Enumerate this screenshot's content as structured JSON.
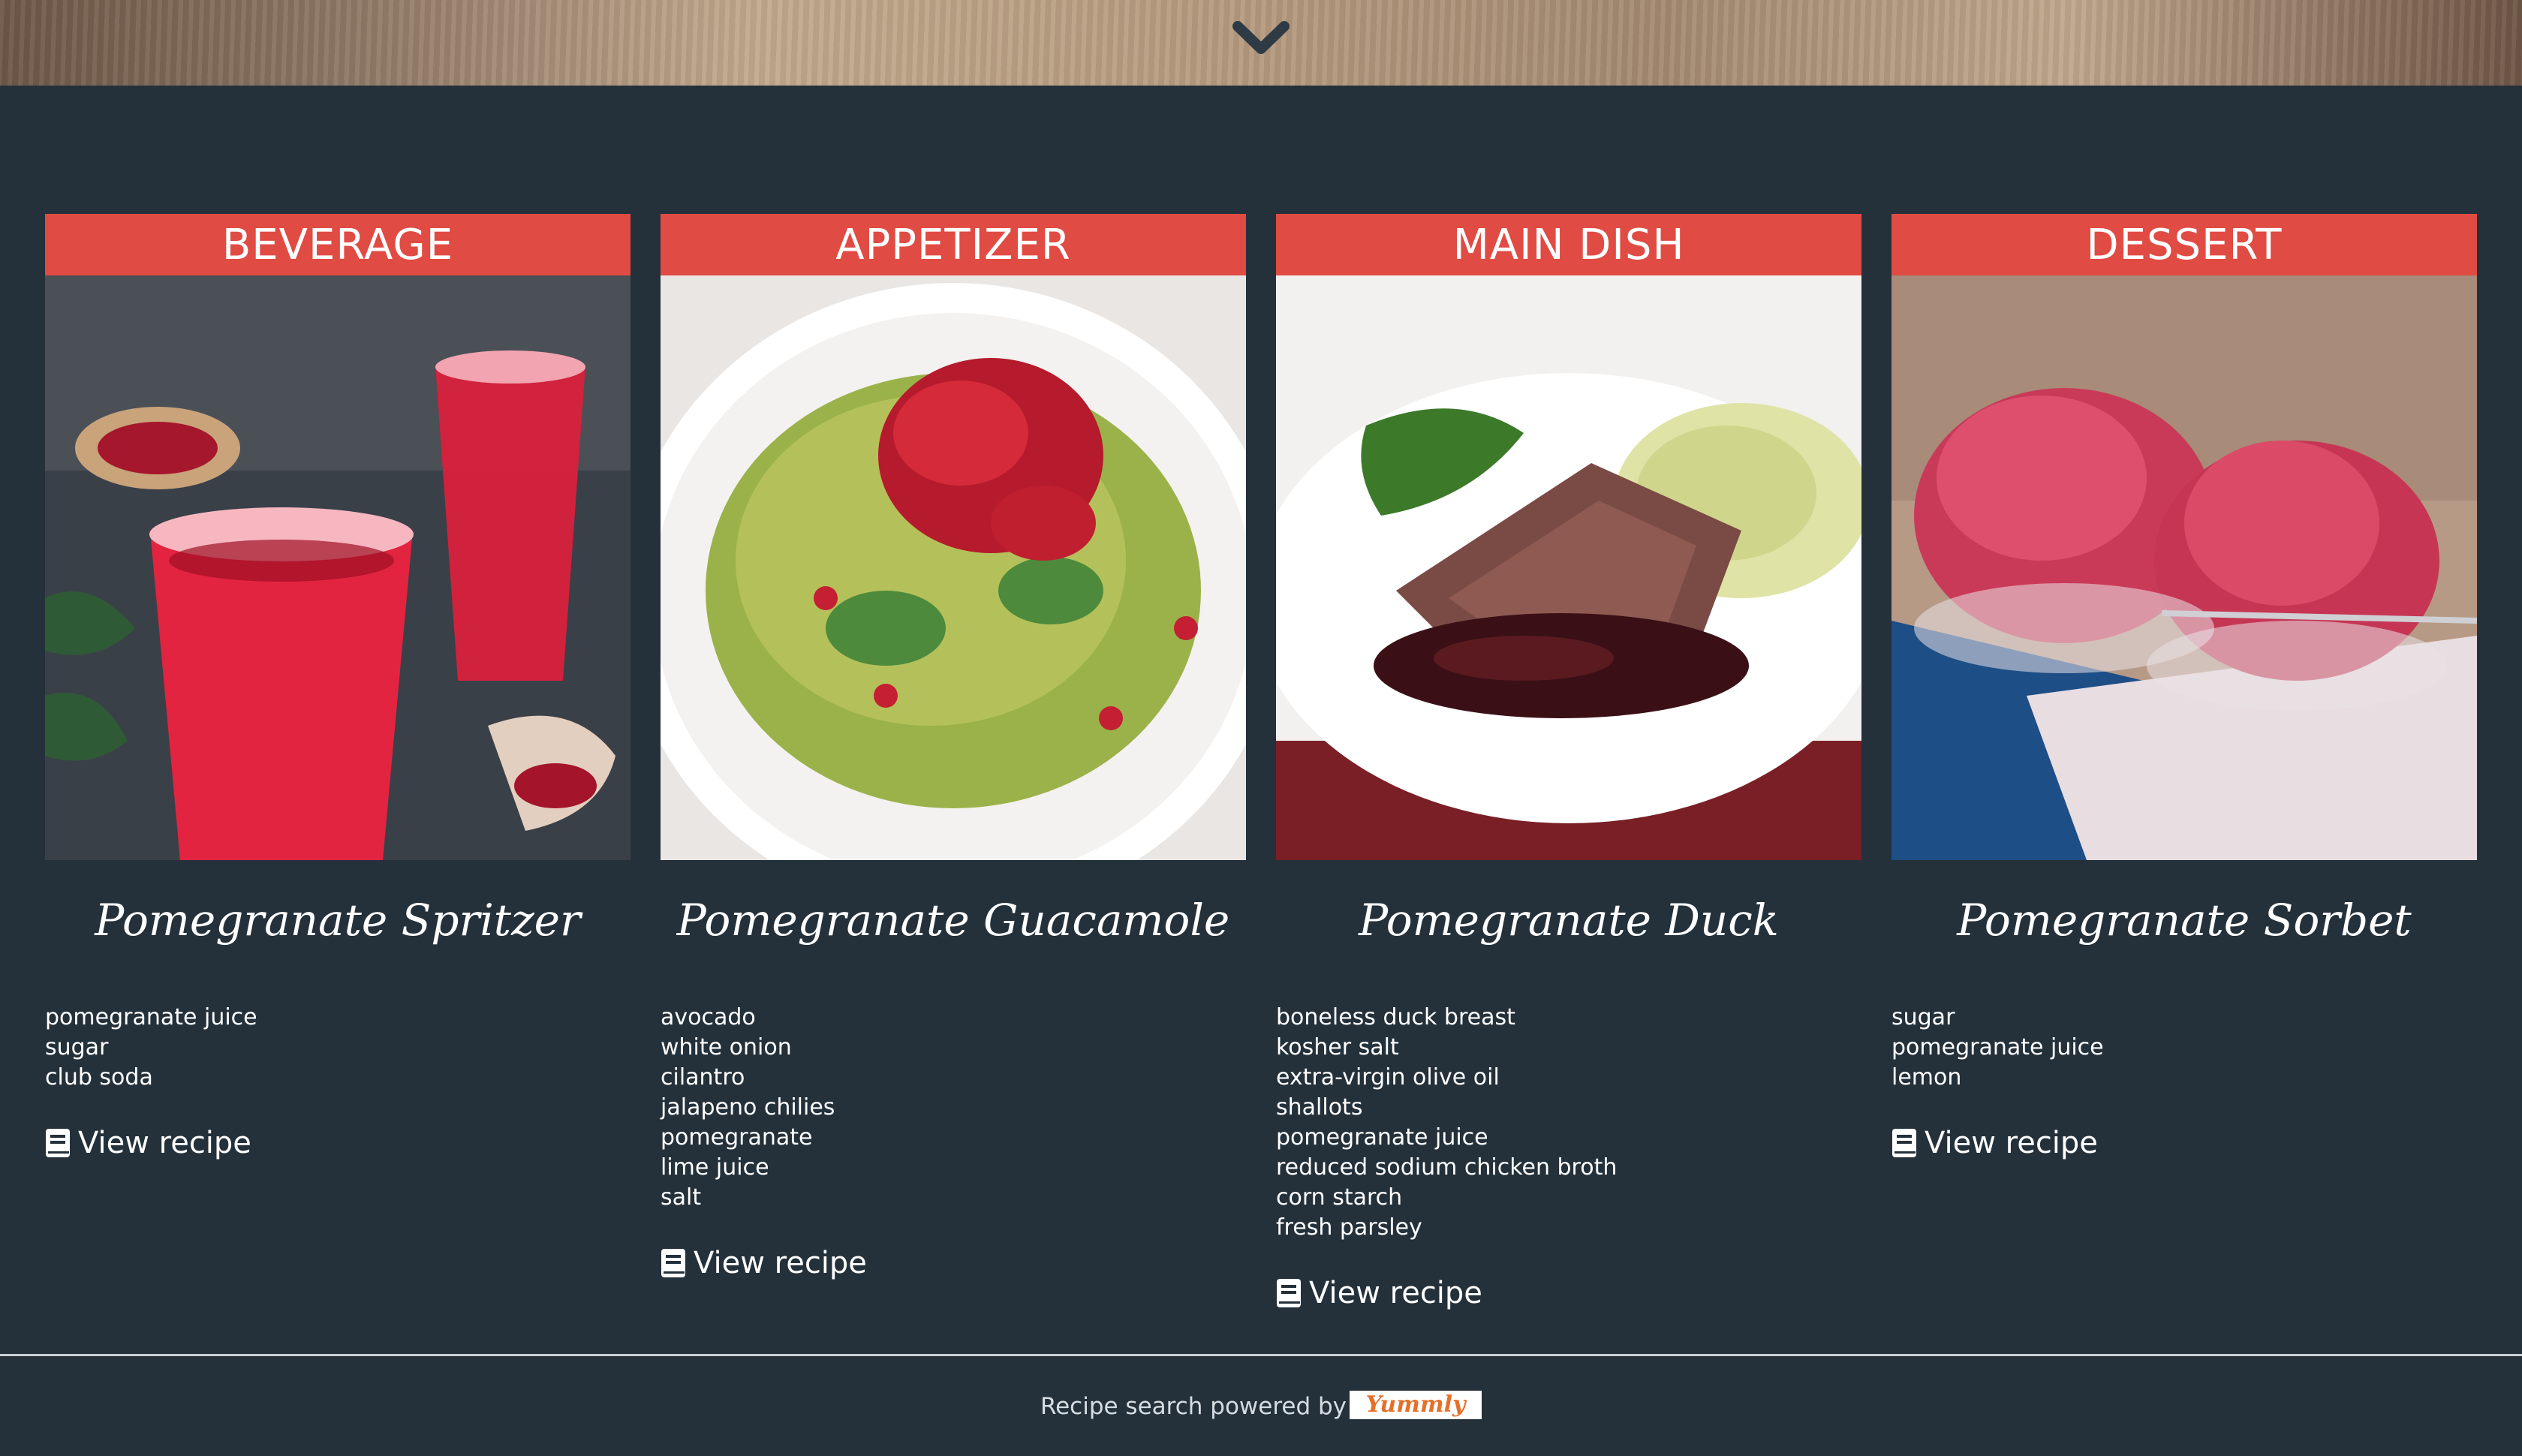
{
  "hero": {
    "scroll_icon": "chevron-down-icon"
  },
  "cards": [
    {
      "category": "BEVERAGE",
      "title": "Pomegranate Spritzer",
      "ingredients": [
        "pomegranate juice",
        "sugar",
        "club soda"
      ],
      "cta": "View recipe"
    },
    {
      "category": "APPETIZER",
      "title": "Pomegranate Guacamole",
      "ingredients": [
        "avocado",
        "white onion",
        "cilantro",
        "jalapeno chilies",
        "pomegranate",
        "lime juice",
        "salt"
      ],
      "cta": "View recipe"
    },
    {
      "category": "MAIN DISH",
      "title": "Pomegranate Duck",
      "ingredients": [
        "boneless duck breast",
        "kosher salt",
        "extra-virgin olive oil",
        "shallots",
        "pomegranate juice",
        "reduced sodium chicken broth",
        "corn starch",
        "fresh parsley"
      ],
      "cta": "View recipe"
    },
    {
      "category": "DESSERT",
      "title": "Pomegranate Sorbet",
      "ingredients": [
        "sugar",
        "pomegranate juice",
        "lemon"
      ],
      "cta": "View recipe"
    }
  ],
  "footer": {
    "text": "Recipe search powered by",
    "logo_text": "Yummly"
  },
  "colors": {
    "background": "#24313b",
    "accent": "#e04b43",
    "footer_rule": "#c7cfd5",
    "logo": "#e5702a"
  }
}
